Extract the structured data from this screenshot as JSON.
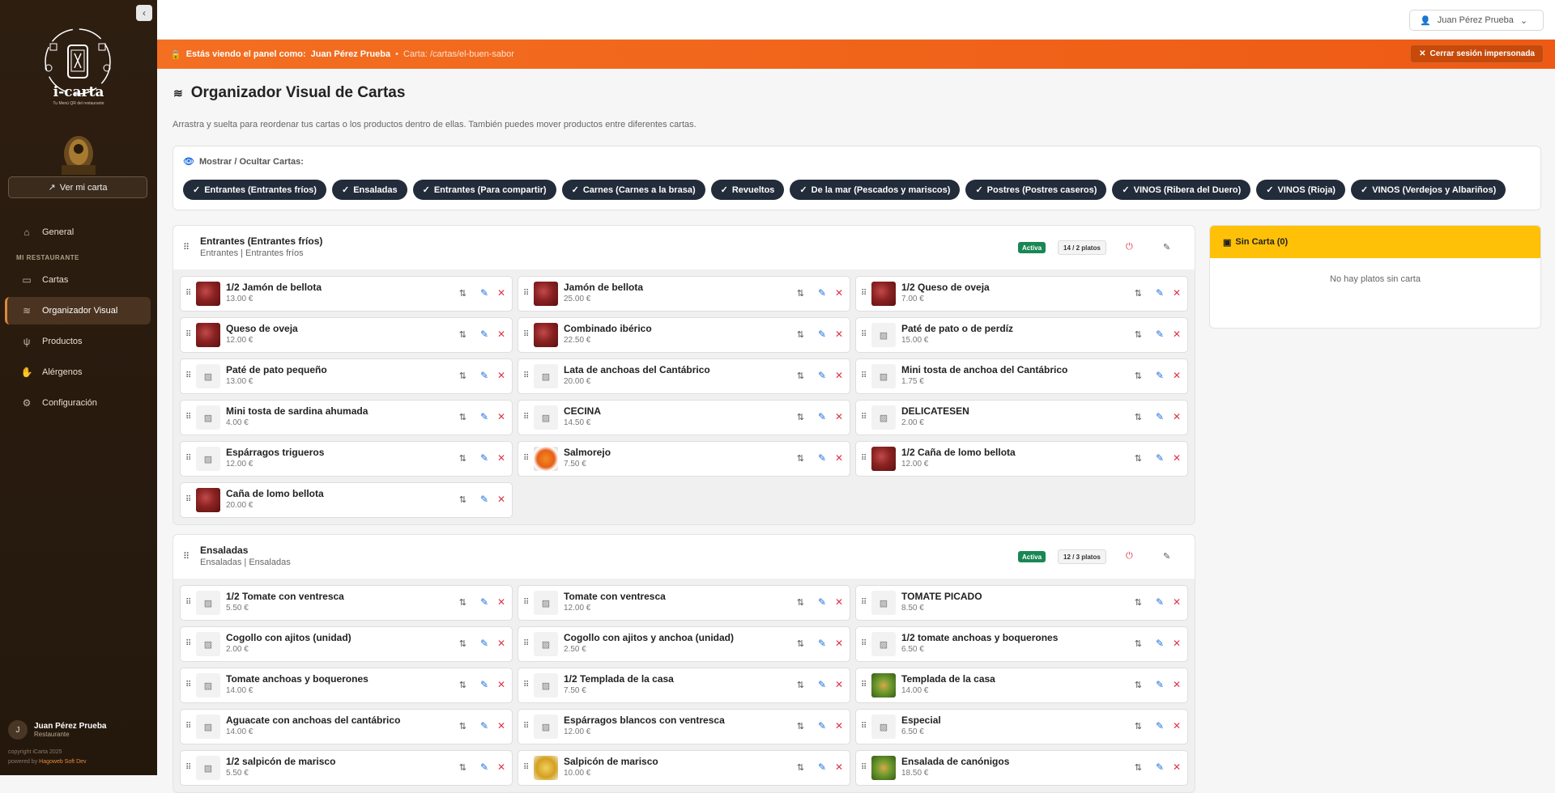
{
  "sidebar": {
    "logo_title": "i-carta",
    "logo_subtitle": "Tu Menú QR del restaurante",
    "view_button": "Ver mi carta",
    "section_label": "MI RESTAURANTE",
    "items": [
      {
        "label": "General",
        "icon": "home-icon"
      },
      {
        "label": "Cartas",
        "icon": "book-icon"
      },
      {
        "label": "Organizador Visual",
        "icon": "layers-icon",
        "active": true
      },
      {
        "label": "Productos",
        "icon": "utensils-icon"
      },
      {
        "label": "Alérgenos",
        "icon": "hand-icon"
      },
      {
        "label": "Configuración",
        "icon": "gear-icon"
      }
    ],
    "user": {
      "initial": "J",
      "name": "Juan Pérez Prueba",
      "role": "Restaurante"
    },
    "copyright": "copyright iCarta 2025",
    "powered_prefix": "powered by",
    "powered_by": "Hagoweb Soft Dev"
  },
  "topbar": {
    "user_dropdown": "Juan Pérez Prueba"
  },
  "banner": {
    "prefix": "Estás viendo el panel como:",
    "user": "Juan Pérez Prueba",
    "separator": "•",
    "path": "Carta: /cartas/el-buen-sabor",
    "end_button": "Cerrar sesión impersonada"
  },
  "page": {
    "title": "Organizador Visual de Cartas",
    "description": "Arrastra y suelta para reordenar tus cartas o los productos dentro de ellas. También puedes mover productos entre diferentes cartas."
  },
  "filter": {
    "title": "Mostrar / Ocultar Cartas:",
    "chips": [
      "Entrantes (Entrantes fríos)",
      "Ensaladas",
      "Entrantes (Para compartir)",
      "Carnes (Carnes a la brasa)",
      "Revueltos",
      "De la mar (Pescados y mariscos)",
      "Postres (Postres caseros)",
      "VINOS (Ribera del Duero)",
      "VINOS (Rioja)",
      "VINOS (Verdejos y Albariños)"
    ]
  },
  "menus": [
    {
      "name": "Entrantes (Entrantes fríos)",
      "sub": "Entrantes | Entrantes fríos",
      "status": "Activa",
      "count": "14 / 2 platos",
      "items": [
        {
          "name": "1/2 Jamón de bellota",
          "price": "13.00 €",
          "img": "jamon"
        },
        {
          "name": "Jamón de bellota",
          "price": "25.00 €",
          "img": "jamon"
        },
        {
          "name": "1/2 Queso de oveja",
          "price": "7.00 €",
          "img": "jamon"
        },
        {
          "name": "Queso de oveja",
          "price": "12.00 €",
          "img": "jamon"
        },
        {
          "name": "Combinado ibérico",
          "price": "22.50 €",
          "img": "jamon"
        },
        {
          "name": "Paté de pato o de perdíz",
          "price": "15.00 €",
          "img": ""
        },
        {
          "name": "Paté de pato pequeño",
          "price": "13.00 €",
          "img": ""
        },
        {
          "name": "Lata de anchoas del Cantábrico",
          "price": "20.00 €",
          "img": ""
        },
        {
          "name": "Mini tosta de anchoa del Cantábrico",
          "price": "1.75 €",
          "img": ""
        },
        {
          "name": "Mini tosta de sardina ahumada",
          "price": "4.00 €",
          "img": ""
        },
        {
          "name": "CECINA",
          "price": "14.50 €",
          "img": ""
        },
        {
          "name": "DELICATESEN",
          "price": "2.00 €",
          "img": ""
        },
        {
          "name": "Espárragos trigueros",
          "price": "12.00 €",
          "img": ""
        },
        {
          "name": "Salmorejo",
          "price": "7.50 €",
          "img": "salmorejo"
        },
        {
          "name": "1/2 Caña de lomo bellota",
          "price": "12.00 €",
          "img": "jamon"
        },
        {
          "name": "Caña de lomo bellota",
          "price": "20.00 €",
          "img": "jamon"
        }
      ]
    },
    {
      "name": "Ensaladas",
      "sub": "Ensaladas | Ensaladas",
      "status": "Activa",
      "count": "12 / 3 platos",
      "items": [
        {
          "name": "1/2 Tomate con ventresca",
          "price": "5.50 €",
          "img": ""
        },
        {
          "name": "Tomate con ventresca",
          "price": "12.00 €",
          "img": ""
        },
        {
          "name": "TOMATE PICADO",
          "price": "8.50 €",
          "img": ""
        },
        {
          "name": "Cogollo con ajitos (unidad)",
          "price": "2.00 €",
          "img": ""
        },
        {
          "name": "Cogollo con ajitos y anchoa (unidad)",
          "price": "2.50 €",
          "img": ""
        },
        {
          "name": "1/2 tomate anchoas y boquerones",
          "price": "6.50 €",
          "img": ""
        },
        {
          "name": "Tomate anchoas y boquerones",
          "price": "14.00 €",
          "img": ""
        },
        {
          "name": "1/2 Templada de la casa",
          "price": "7.50 €",
          "img": ""
        },
        {
          "name": "Templada de la casa",
          "price": "14.00 €",
          "img": "salad"
        },
        {
          "name": "Aguacate con anchoas del cantábrico",
          "price": "14.00 €",
          "img": ""
        },
        {
          "name": "Espárragos blancos con ventresca",
          "price": "12.00 €",
          "img": ""
        },
        {
          "name": "Especial",
          "price": "6.50 €",
          "img": ""
        },
        {
          "name": "1/2 salpicón de marisco",
          "price": "5.50 €",
          "img": ""
        },
        {
          "name": "Salpicón de marisco",
          "price": "10.00 €",
          "img": "seafood"
        },
        {
          "name": "Ensalada de canónigos",
          "price": "18.50 €",
          "img": "salad"
        }
      ]
    }
  ],
  "no_menu": {
    "title": "Sin Carta (0)",
    "empty": "No hay platos sin carta"
  },
  "colors": {
    "banner": "#f36f21",
    "active_badge": "#198754",
    "chip": "#222c3a",
    "no_menu_header": "#ffc107",
    "edit": "#1d6fe0",
    "delete": "#dc3545"
  }
}
